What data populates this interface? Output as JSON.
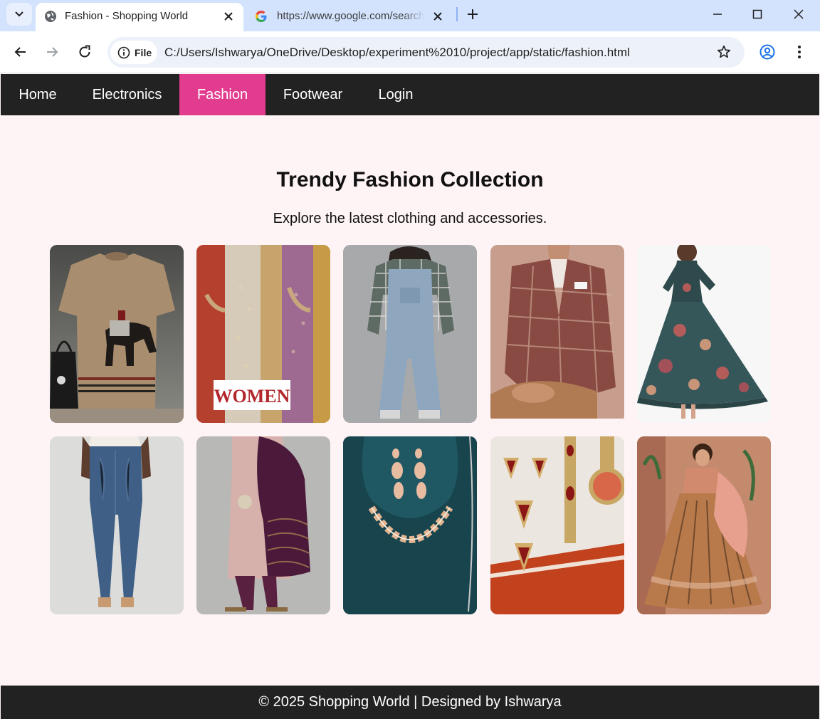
{
  "browser": {
    "tabs": [
      {
        "title": "Fashion - Shopping World",
        "favicon": "globe-icon",
        "active": true
      },
      {
        "title": "https://www.google.com/search",
        "favicon": "google-icon",
        "active": false
      }
    ],
    "address_chip": "File",
    "url": "C:/Users/Ishwarya/OneDrive/Desktop/experiment%2010/project/app/static/fashion.html"
  },
  "site": {
    "nav": [
      {
        "label": "Home",
        "active": false
      },
      {
        "label": "Electronics",
        "active": false
      },
      {
        "label": "Fashion",
        "active": true
      },
      {
        "label": "Footwear",
        "active": false
      },
      {
        "label": "Login",
        "active": false
      }
    ],
    "title": "Trendy Fashion Collection",
    "subtitle": "Explore the latest clothing and accessories.",
    "products": [
      {
        "image": "beige-tshirt-horse-print"
      },
      {
        "image": "women-ethnic-kurtas",
        "overlay_text": "WOMEN"
      },
      {
        "image": "kids-denim-dungaree"
      },
      {
        "image": "mens-plaid-blazer"
      },
      {
        "image": "floral-maxi-dress"
      },
      {
        "image": "blue-skinny-jeans"
      },
      {
        "image": "purple-silk-dupatta-suit"
      },
      {
        "image": "gold-necklace-earring-set"
      },
      {
        "image": "ruby-jewellery-and-watch"
      },
      {
        "image": "peach-lehenga"
      }
    ],
    "footer": "© 2025 Shopping World | Designed by Ishwarya"
  },
  "colors": {
    "nav_bg": "#222222",
    "nav_active": "#e23c8e",
    "page_bg": "#fff4f5",
    "tabstrip_bg": "#d3e3fd"
  }
}
